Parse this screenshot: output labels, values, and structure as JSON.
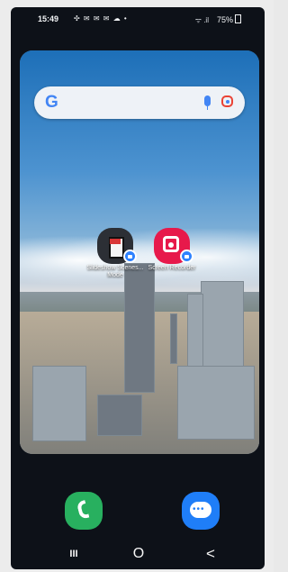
{
  "status_bar": {
    "time": "15:49",
    "notification_icons": "✣ ✉ ✉ ✉ ☁ •",
    "signal": "ᯤ .il",
    "battery": "75%"
  },
  "search": {
    "google_label": "G"
  },
  "apps": [
    {
      "label": "Slideshow Scenes... Mode"
    },
    {
      "label": "Screen Recorder"
    }
  ],
  "dock": {
    "phone_label": "",
    "messages_label": ""
  },
  "navigation": {
    "recent_label": "III",
    "home_label": "O",
    "back_label": "<"
  },
  "colors": {
    "accent": "#2e82ff",
    "status_text": "#f1f3f5"
  }
}
